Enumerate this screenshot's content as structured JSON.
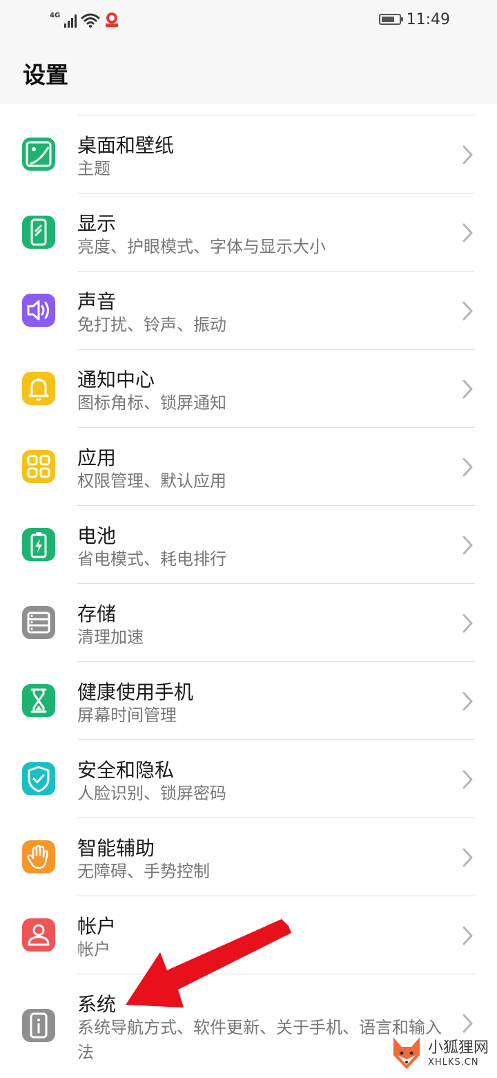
{
  "status_bar": {
    "network": "4G",
    "time": "11:49",
    "battery_level": 0.75
  },
  "header": {
    "title": "设置"
  },
  "settings_items": [
    {
      "title": "桌面和壁纸",
      "subtitle": "主题",
      "icon": "wallpaper-icon",
      "color": "#1db370"
    },
    {
      "title": "显示",
      "subtitle": "亮度、护眼模式、字体与显示大小",
      "icon": "display-icon",
      "color": "#1db370"
    },
    {
      "title": "声音",
      "subtitle": "免打扰、铃声、振动",
      "icon": "sound-icon",
      "color": "#8a5cf0"
    },
    {
      "title": "通知中心",
      "subtitle": "图标角标、锁屏通知",
      "icon": "bell-icon",
      "color": "#f6c21a"
    },
    {
      "title": "应用",
      "subtitle": "权限管理、默认应用",
      "icon": "apps-grid-icon",
      "color": "#f6c21a"
    },
    {
      "title": "电池",
      "subtitle": "省电模式、耗电排行",
      "icon": "battery-icon",
      "color": "#1db370"
    },
    {
      "title": "存储",
      "subtitle": "清理加速",
      "icon": "storage-icon",
      "color": "#8f8f8f"
    },
    {
      "title": "健康使用手机",
      "subtitle": "屏幕时间管理",
      "icon": "hourglass-icon",
      "color": "#1db370"
    },
    {
      "title": "安全和隐私",
      "subtitle": "人脸识别、锁屏密码",
      "icon": "shield-icon",
      "color": "#19bfc4"
    },
    {
      "title": "智能辅助",
      "subtitle": "无障碍、手势控制",
      "icon": "hand-icon",
      "color": "#f5962a"
    },
    {
      "title": "帐户",
      "subtitle": "帐户",
      "icon": "account-icon",
      "color": "#f05555"
    },
    {
      "title": "系统",
      "subtitle": "系统导航方式、软件更新、关于手机、语言和输入法",
      "icon": "system-info-icon",
      "color": "#8f8f8f"
    }
  ],
  "watermark": {
    "name": "小狐狸网",
    "domain": "XHLKS.CN"
  }
}
